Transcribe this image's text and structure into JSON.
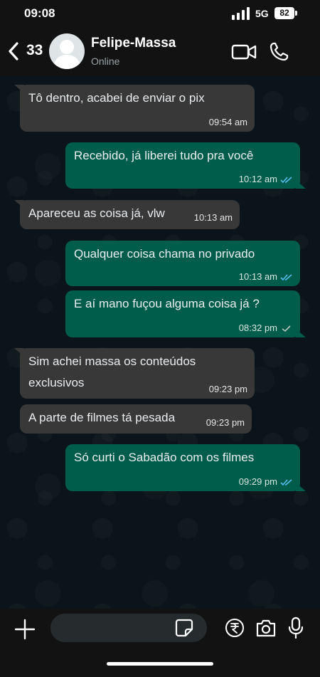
{
  "status_bar": {
    "time": "09:08",
    "network": "5G",
    "battery": "82"
  },
  "header": {
    "unread_count": "33",
    "contact_name": "Felipe-Massa",
    "contact_status": "Online"
  },
  "messages": [
    {
      "direction": "in",
      "text": "Tô dentro, acabei de enviar o pix",
      "time": "09:54 am"
    },
    {
      "direction": "out",
      "text": "Recebido, já liberei tudo pra você",
      "time": "10:12 am",
      "ticks": "read"
    },
    {
      "direction": "in",
      "text": "Apareceu as coisa já, vlw",
      "time": "10:13 am"
    },
    {
      "direction": "out",
      "text": "Qualquer coisa chama no privado",
      "time": "10:13 am",
      "ticks": "read"
    },
    {
      "direction": "out",
      "text": "E aí mano fuçou alguma coisa já ?",
      "time": "08:32 pm",
      "ticks": "sent"
    },
    {
      "direction": "in",
      "text_line1": "Sim achei massa os conteúdos",
      "text_line2": "exclusivos",
      "time": "09:23 pm"
    },
    {
      "direction": "in",
      "text": "A parte de filmes tá pesada",
      "time": "09:23 pm"
    },
    {
      "direction": "out",
      "text": "Só curti o Sabadão com os filmes",
      "time": "09:29 pm",
      "ticks": "read"
    }
  ],
  "input": {
    "placeholder": ""
  },
  "colors": {
    "outgoing_bubble": "#005c4b",
    "incoming_bubble": "#383838",
    "read_tick": "#53bdeb",
    "chat_background": "#0b141a"
  },
  "icons": [
    "back-chevron-icon",
    "avatar-placeholder-icon",
    "video-call-icon",
    "phone-icon",
    "plus-icon",
    "sticker-icon",
    "rupee-payment-icon",
    "camera-icon",
    "mic-icon"
  ]
}
